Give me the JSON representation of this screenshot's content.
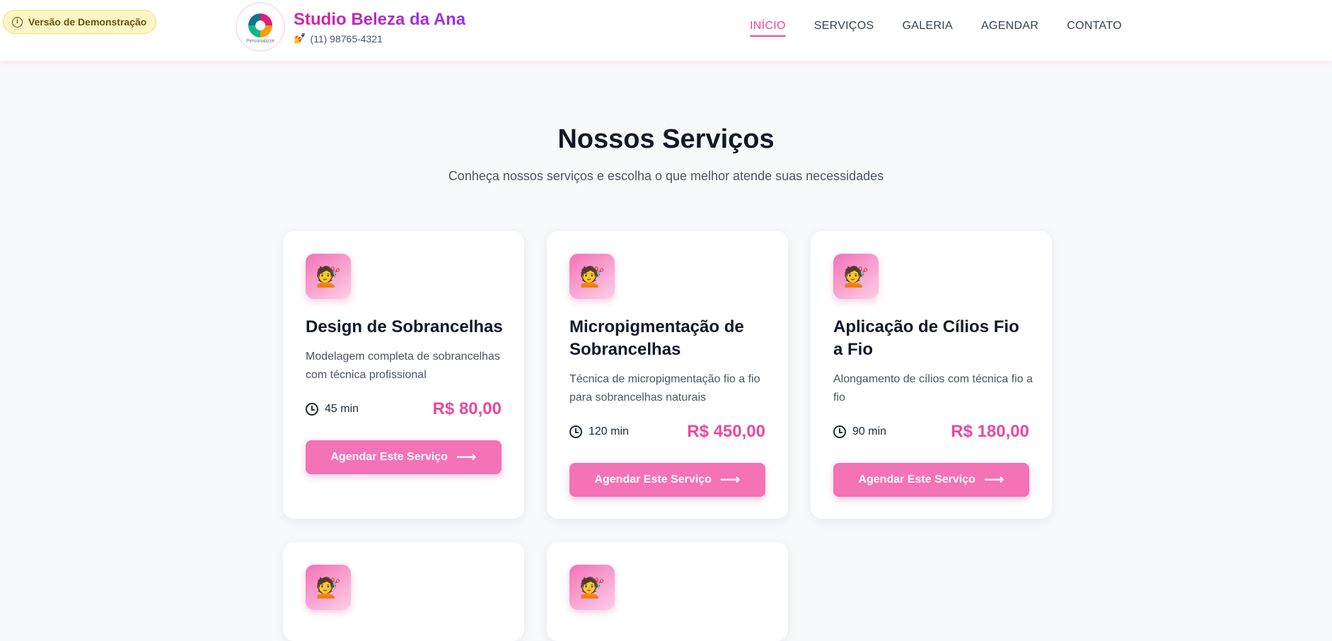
{
  "demo_badge": {
    "label": "Versão de Demonstração",
    "icon": "info-icon"
  },
  "logo": {
    "text": "Personalizze"
  },
  "brand": {
    "name": "Studio Beleza da Ana",
    "phone_icon": "💅",
    "phone": "(11) 98765-4321"
  },
  "nav": {
    "items": [
      {
        "label": "INÍCIO",
        "active": true
      },
      {
        "label": "SERVIÇOS",
        "active": false
      },
      {
        "label": "GALERIA",
        "active": false
      },
      {
        "label": "AGENDAR",
        "active": false
      },
      {
        "label": "CONTATO",
        "active": false
      }
    ]
  },
  "section": {
    "title": "Nossos Serviços",
    "subtitle": "Conheça nossos serviços e escolha o que melhor atende suas necessidades"
  },
  "services": [
    {
      "icon": "💇",
      "title": "Design de Sobrancelhas",
      "description": "Modelagem completa de sobrancelhas com técnica profissional",
      "duration": "45 min",
      "price": "R$ 80,00",
      "button": "Agendar Este Serviço"
    },
    {
      "icon": "💇",
      "title": "Micropigmentação de Sobrancelhas",
      "description": "Técnica de micropigmentação fio a fio para sobrancelhas naturais",
      "duration": "120 min",
      "price": "R$ 450,00",
      "button": "Agendar Este Serviço"
    },
    {
      "icon": "💇",
      "title": "Aplicação de Cílios Fio a Fio",
      "description": "Alongamento de cílios com técnica fio a fio",
      "duration": "90 min",
      "price": "R$ 180,00",
      "button": "Agendar Este Serviço"
    },
    {
      "icon": "💇"
    },
    {
      "icon": "💇"
    }
  ],
  "colors": {
    "accent": "#ec4899",
    "button": "#f472b6",
    "brand": "#c026d3"
  }
}
